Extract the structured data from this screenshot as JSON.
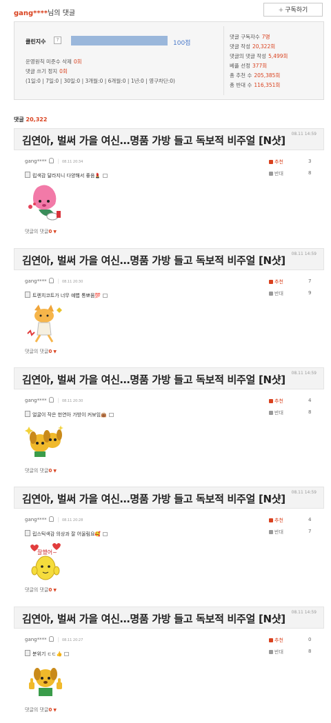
{
  "header": {
    "nickname": "gang****",
    "suffix": "님의 댓글",
    "subscribe_label": "구독하기",
    "subscribe_icon": "plus-icon"
  },
  "stats": {
    "clean_label": "클린지수",
    "clean_score": "100점",
    "clean_fraction": 1.0,
    "policy_label": "운영원칙 미준수 삭제",
    "policy_value": "0회",
    "ban_label": "댓글 쓰기 정지",
    "ban_value": "0회",
    "ban_detail": "(1일:0 | 7일:0 | 30일:0 | 3개월:0 | 6개월:0 | 1년:0 | 영구차단:0)",
    "subscribers_label": "댓글 구독자수",
    "subscribers_value": "7명",
    "written_label": "댓글 작성",
    "written_value": "20,322회",
    "reply_label": "댓글의 댓글 작성",
    "reply_value": "5,499회",
    "best_label": "베플 선정",
    "best_value": "377회",
    "likes_label": "총 추천 수",
    "likes_value": "205,385회",
    "dislikes_label": "총 반대 수",
    "dislikes_value": "116,351회"
  },
  "comment_count": {
    "label": "댓글",
    "value": "20,322"
  },
  "comments": [
    {
      "article_title": "김연아, 벌써 가을 여신…명품 가방 들고 독보적 비주얼 [N샷]",
      "article_date": "08.11 14:59",
      "author": "gang****",
      "time": "08.11 20:34",
      "text": "립색감 달라지니 다양해서 좋음",
      "emoji": "💄",
      "like_label": "추천",
      "likes": "3",
      "dislike_label": "반대",
      "dislikes": "8",
      "reply_label": "댓글의 댓글",
      "replies": "0"
    },
    {
      "article_title": "김연아, 벌써 가을 여신…명품 가방 들고 독보적 비주얼 [N샷]",
      "article_date": "08.11 14:59",
      "author": "gang****",
      "time": "08.11 20:30",
      "text": "트렌치코트가 너무 예뻡 통뽀뭄",
      "emoji": "💯",
      "like_label": "추천",
      "likes": "7",
      "dislike_label": "반대",
      "dislikes": "9",
      "reply_label": "댓글의 댓글",
      "replies": "0"
    },
    {
      "article_title": "김연아, 벌써 가을 여신…명품 가방 들고 독보적 비주얼 [N샷]",
      "article_date": "08.11 14:59",
      "author": "gang****",
      "time": "08.11 20:30",
      "text": "얼굴이 작은 헌연아 가방이 커보임",
      "emoji": "👜",
      "like_label": "추천",
      "likes": "4",
      "dislike_label": "반대",
      "dislikes": "8",
      "reply_label": "댓글의 댓글",
      "replies": "0"
    },
    {
      "article_title": "김연아, 벌써 가을 여신…명품 가방 들고 독보적 비주얼 [N샷]",
      "article_date": "08.11 14:59",
      "author": "gang****",
      "time": "08.11 20:28",
      "text": "립스틱색감 의상과 잘 어울림요",
      "emoji": "🥰",
      "like_label": "추천",
      "likes": "4",
      "dislike_label": "반대",
      "dislikes": "7",
      "reply_label": "댓글의 댓글",
      "replies": "0"
    },
    {
      "article_title": "김연아, 벌써 가을 여신…명품 가방 들고 독보적 비주얼 [N샷]",
      "article_date": "08.11 14:59",
      "author": "gang****",
      "time": "08.11 20:27",
      "text": "분위기 ㄷㄷ",
      "emoji": "👍",
      "like_label": "추천",
      "likes": "0",
      "dislike_label": "반대",
      "dislikes": "8",
      "reply_label": "댓글의 댓글",
      "replies": "0"
    }
  ],
  "stickers": [
    {
      "icon": "strawberry-character-sticker-icon",
      "caption": ""
    },
    {
      "icon": "dancing-fox-sticker-icon",
      "caption": ""
    },
    {
      "icon": "sparkle-dogs-sticker-icon",
      "caption": ""
    },
    {
      "icon": "lemon-hearts-sticker-icon",
      "caption": "잘했어~"
    },
    {
      "icon": "thumbs-up-dog-sticker-icon",
      "caption": ""
    }
  ],
  "colors": {
    "accent": "#d9411e",
    "bar": "#9ab7db",
    "score": "#4a79c9",
    "title_bg": "#f3f3f3"
  }
}
